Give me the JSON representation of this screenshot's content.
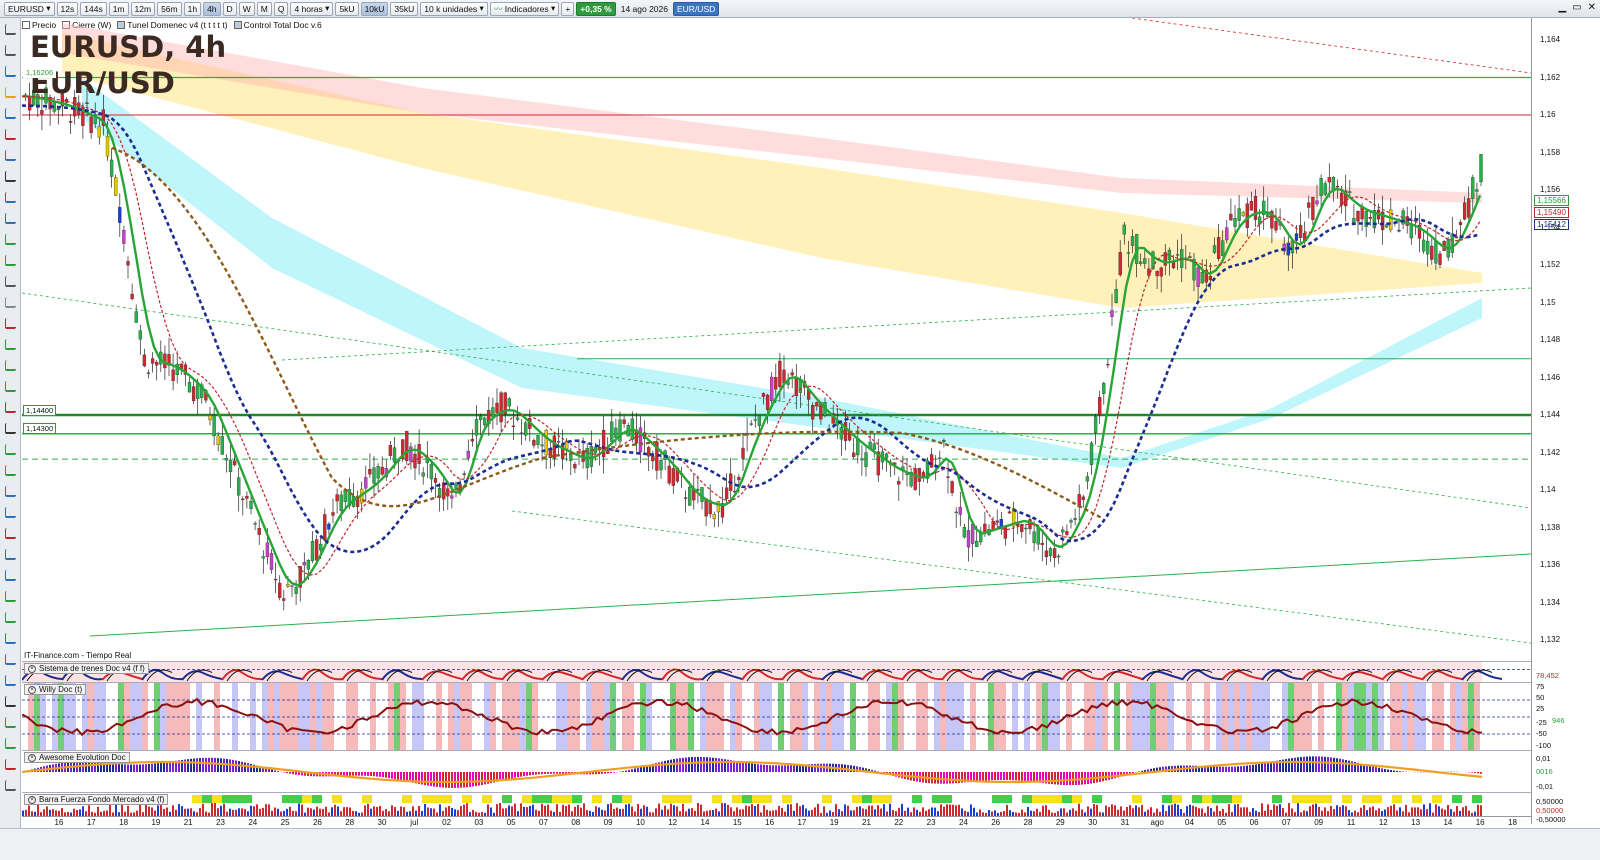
{
  "toolbar": {
    "symbol": "EURUSD",
    "timeframes": [
      "12s",
      "144s",
      "1m",
      "12m",
      "56m",
      "1h",
      "4h",
      "D",
      "W",
      "M",
      "Q"
    ],
    "active_timeframe": "4h",
    "period_select": "4 horas",
    "volume_buttons": [
      "5kU",
      "10kU",
      "35kU"
    ],
    "active_volume": "10kU",
    "units_select": "10 k unidades",
    "indicators_label": "Indicadores",
    "change_pct": "+0,35 %",
    "date": "14 ago 2026",
    "instrument": "EUR/USD"
  },
  "infobar": {
    "items": [
      "Precio",
      "Cierre (W)",
      "Tunel Domenec v4 (t t t t t)",
      "Control Total Doc v.6"
    ]
  },
  "chart": {
    "title": "EURUSD, 4h",
    "subtitle": "EUR/USD",
    "source": "IT-Finance.com - Tiempo Real",
    "left_labels": [
      "1,16206",
      "1,14400",
      "1,14300"
    ],
    "y_ticks": [
      "1,164",
      "1,162",
      "1,16",
      "1,158",
      "1,156",
      "1,154",
      "1,152",
      "1,15",
      "1,148",
      "1,146",
      "1,144",
      "1,142",
      "1,14",
      "1,138",
      "1,136",
      "1,134",
      "1,132"
    ],
    "price_labels": [
      {
        "text": "1,15566",
        "color": "#2e9b3f"
      },
      {
        "text": "1,15490",
        "color": "#c0272d"
      },
      {
        "text": "1,15412",
        "color": "#1a2f8f"
      }
    ],
    "colors": {
      "up": "#2ab04a",
      "down": "#d0282f",
      "ema_fast": "#27a536",
      "ema_slow": "#1c2d92",
      "trend": "#8d5a1a"
    }
  },
  "panels": [
    {
      "name": "Sistema de trenes Doc v4 (f f)",
      "values": [
        "78,452",
        "75",
        "50",
        "25"
      ]
    },
    {
      "name": "Willy Doc (t)",
      "values": [
        "-25",
        "946",
        "-50",
        "-100"
      ]
    },
    {
      "name": "Awesome Evolution Doc",
      "values": [
        "0,01",
        "0016",
        "-0,01"
      ]
    },
    {
      "name": "Barra Fuerza Fondo Mercado v4 (f)",
      "values": [
        "0,50000",
        "0,50000",
        "-0,50000"
      ]
    }
  ],
  "xaxis": {
    "labels": [
      "16",
      "17",
      "18",
      "19",
      "21",
      "23",
      "24",
      "25",
      "26",
      "28",
      "30",
      "jul",
      "02",
      "03",
      "05",
      "07",
      "08",
      "09",
      "10",
      "12",
      "14",
      "15",
      "16",
      "17",
      "19",
      "21",
      "22",
      "23",
      "24",
      "26",
      "28",
      "29",
      "30",
      "31",
      "ago",
      "04",
      "05",
      "06",
      "07",
      "09",
      "11",
      "12",
      "13",
      "14",
      "16",
      "18"
    ]
  }
}
